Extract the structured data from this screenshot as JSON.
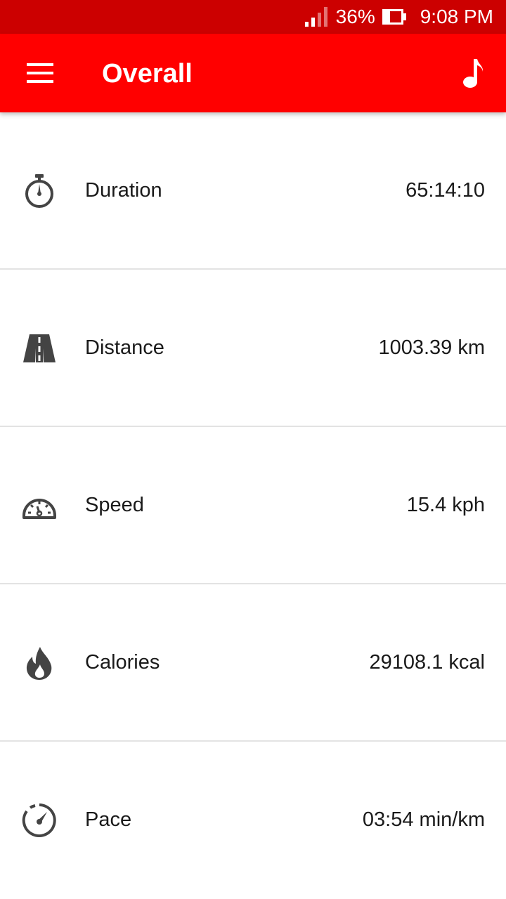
{
  "status_bar": {
    "battery_percent": "36%",
    "time": "9:08 PM",
    "battery_level": 0.36
  },
  "app_bar": {
    "title": "Overall",
    "menu_icon": "hamburger-menu-icon",
    "music_icon": "music-note-icon",
    "color": "#ff0000"
  },
  "stats": [
    {
      "icon": "stopwatch-icon",
      "label": "Duration",
      "value": "65:14:10"
    },
    {
      "icon": "road-icon",
      "label": "Distance",
      "value": "1003.39 km"
    },
    {
      "icon": "speedometer-icon",
      "label": "Speed",
      "value": "15.4 kph"
    },
    {
      "icon": "flame-icon",
      "label": "Calories",
      "value": "29108.1 kcal"
    },
    {
      "icon": "pace-gauge-icon",
      "label": "Pace",
      "value": "03:54 min/km"
    }
  ]
}
